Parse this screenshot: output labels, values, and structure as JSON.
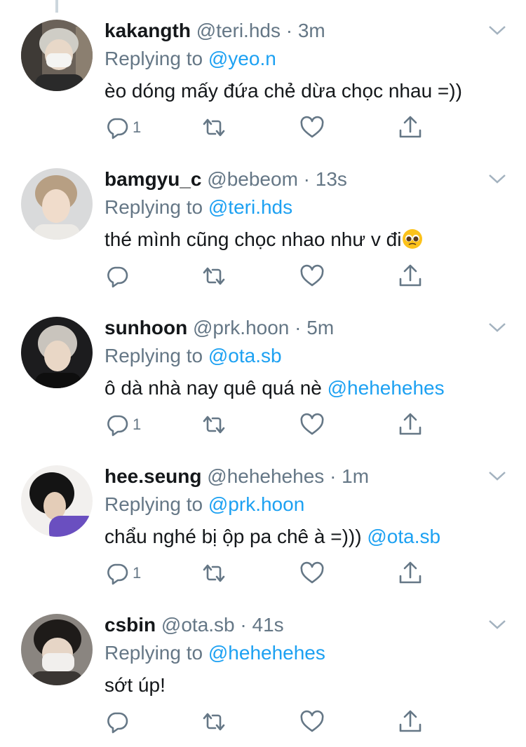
{
  "tweets": [
    {
      "name": "kakangth",
      "handle": "@teri.hds",
      "dot": "·",
      "time": "3m",
      "reply_prefix": "Replying to",
      "reply_to": "@yeo.n",
      "text": "èo dóng mấy đứa chẻ dừa chọc nhau =))",
      "mention": "",
      "emoji": "",
      "reply_count": "1"
    },
    {
      "name": "bamgyu_c",
      "handle": "@bebeom",
      "dot": "·",
      "time": "13s",
      "reply_prefix": "Replying to",
      "reply_to": "@teri.hds",
      "text": "thé mình cũng chọc nhao như v đi",
      "mention": "",
      "emoji": "pleading-face-emoji",
      "reply_count": ""
    },
    {
      "name": "sunhoon",
      "handle": "@prk.hoon",
      "dot": "·",
      "time": "5m",
      "reply_prefix": "Replying to",
      "reply_to": "@ota.sb",
      "text": "ô dà nhà nay quê quá nè ",
      "mention": "@hehehehes",
      "emoji": "",
      "reply_count": "1"
    },
    {
      "name": "hee.seung",
      "handle": "@hehehehes",
      "dot": "·",
      "time": "1m",
      "reply_prefix": "Replying to",
      "reply_to": "@prk.hoon",
      "text": "chẩu nghé bị ộp pa chê à =))) ",
      "mention": "@ota.sb",
      "emoji": "",
      "reply_count": "1"
    },
    {
      "name": "csbin",
      "handle": "@ota.sb",
      "dot": "·",
      "time": "41s",
      "reply_prefix": "Replying to",
      "reply_to": "@hehehehes",
      "text": "sớt úp!",
      "mention": "",
      "emoji": "",
      "reply_count": ""
    }
  ],
  "icons": {
    "reply": "reply-icon",
    "retweet": "retweet-icon",
    "like": "like-icon",
    "share": "share-icon",
    "more": "chevron-down-icon"
  },
  "colors": {
    "link": "#1da1f2",
    "secondary": "#657786",
    "text": "#14171a",
    "thread": "#ccd6dd"
  }
}
